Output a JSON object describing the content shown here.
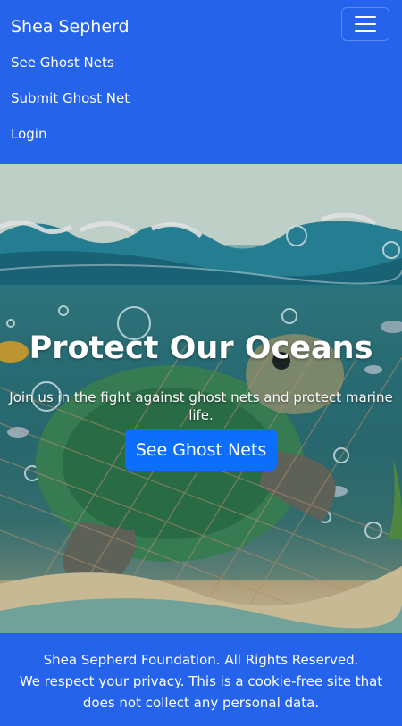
{
  "navbar": {
    "brand": "Shea Sepherd",
    "menu_icon": "hamburger-menu-icon",
    "links": [
      {
        "label": "See Ghost Nets"
      },
      {
        "label": "Submit Ghost Net"
      },
      {
        "label": "Login"
      }
    ]
  },
  "hero": {
    "title": "Protect Our Oceans",
    "subtitle": "Join us in the fight against ghost nets and protect marine life.",
    "button_label": "See Ghost Nets"
  },
  "footer": {
    "copyright": "Shea Sepherd Foundation. All Rights Reserved.",
    "privacy": "We respect your privacy. This is a cookie-free site that does not collect any personal data."
  },
  "colors": {
    "nav_bg": "#2563eb",
    "button_bg": "#0d6efd",
    "text": "#ffffff"
  }
}
